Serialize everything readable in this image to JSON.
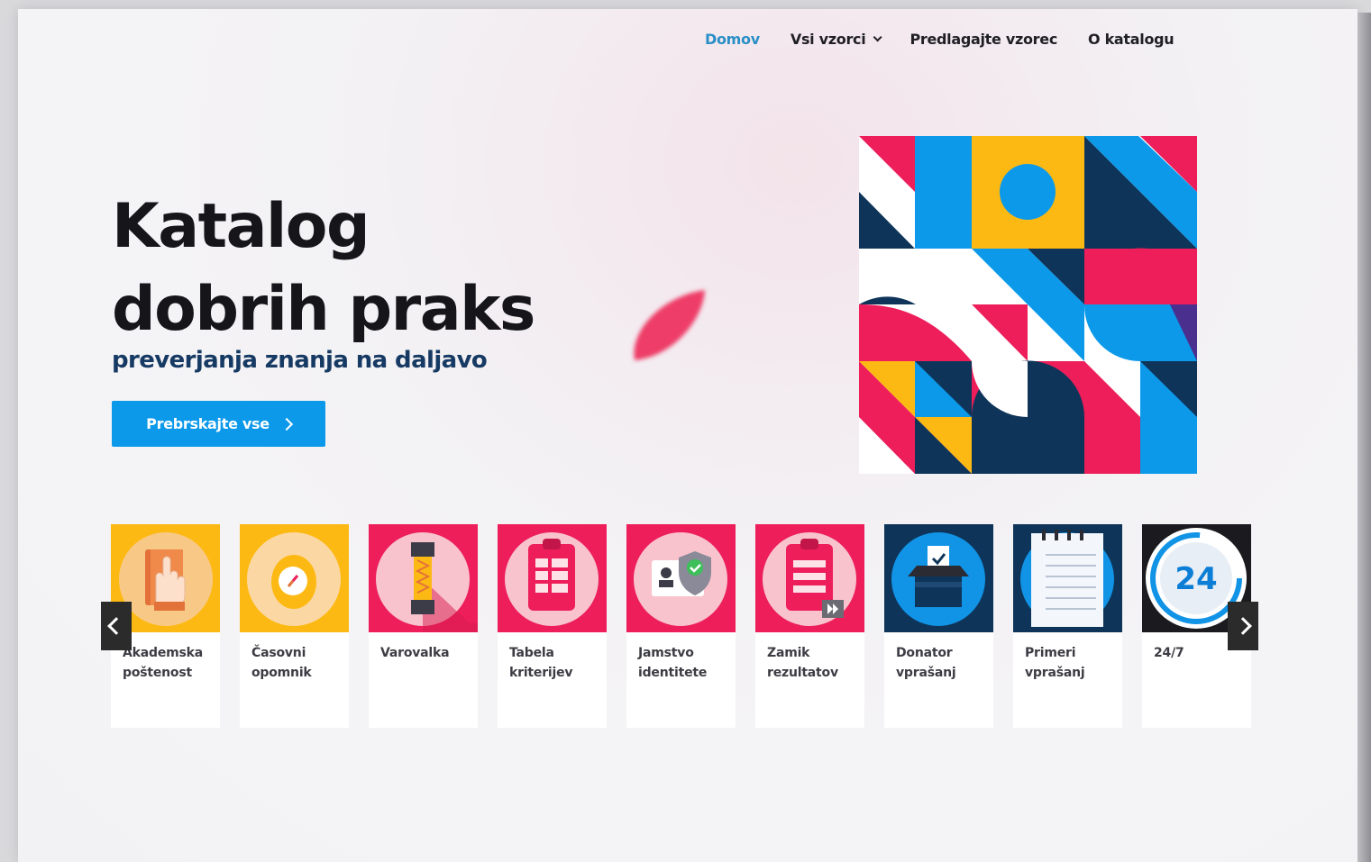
{
  "nav": {
    "items": [
      {
        "label": "Domov",
        "active": true
      },
      {
        "label": "Vsi vzorci",
        "dropdown": true
      },
      {
        "label": "Predlagajte vzorec"
      },
      {
        "label": "O katalogu"
      }
    ]
  },
  "hero": {
    "title_line1": "Katalog",
    "title_line2": "dobrih praks",
    "subtitle": "preverjanja znanja na daljavo",
    "cta_label": "Prebrskajte vse"
  },
  "cards": [
    {
      "label": "Akademska poštenost",
      "icon": "hand-book-icon",
      "bg": "#fdb913",
      "circle": "#f8c986"
    },
    {
      "label": "Časovni opomnik",
      "icon": "egg-timer-icon",
      "bg": "#fdb913",
      "circle": "#fbd8a3"
    },
    {
      "label": "Varovalka",
      "icon": "fuse-icon",
      "bg": "#ed1e5a",
      "circle": "#f8c3cc"
    },
    {
      "label": "Tabela kriterijev",
      "icon": "clipboard-grid-icon",
      "bg": "#ed1e5a",
      "circle": "#f8c3cc"
    },
    {
      "label": "Jamstvo identitete",
      "icon": "id-shield-icon",
      "bg": "#ed1e5a",
      "circle": "#f8c3cc"
    },
    {
      "label": "Zamik rezultatov",
      "icon": "clipboard-delay-icon",
      "bg": "#ed1e5a",
      "circle": "#f8c3cc"
    },
    {
      "label": "Donator vprašanj",
      "icon": "ballot-box-icon",
      "bg": "#0e3559",
      "circle": "#1193e6"
    },
    {
      "label": "Primeri vprašanj",
      "icon": "notepad-icon",
      "bg": "#0e3559",
      "circle": "#1193e6"
    },
    {
      "label": "24/7",
      "icon": "clock-24-icon",
      "bg": "#1b1b1f",
      "circle": "#ffffff"
    }
  ],
  "colors": {
    "accent": "#0c99ea",
    "nav_active": "#2a8fc7",
    "navy": "#163a63",
    "pink": "#ed1e5a",
    "yellow": "#fdb913"
  }
}
